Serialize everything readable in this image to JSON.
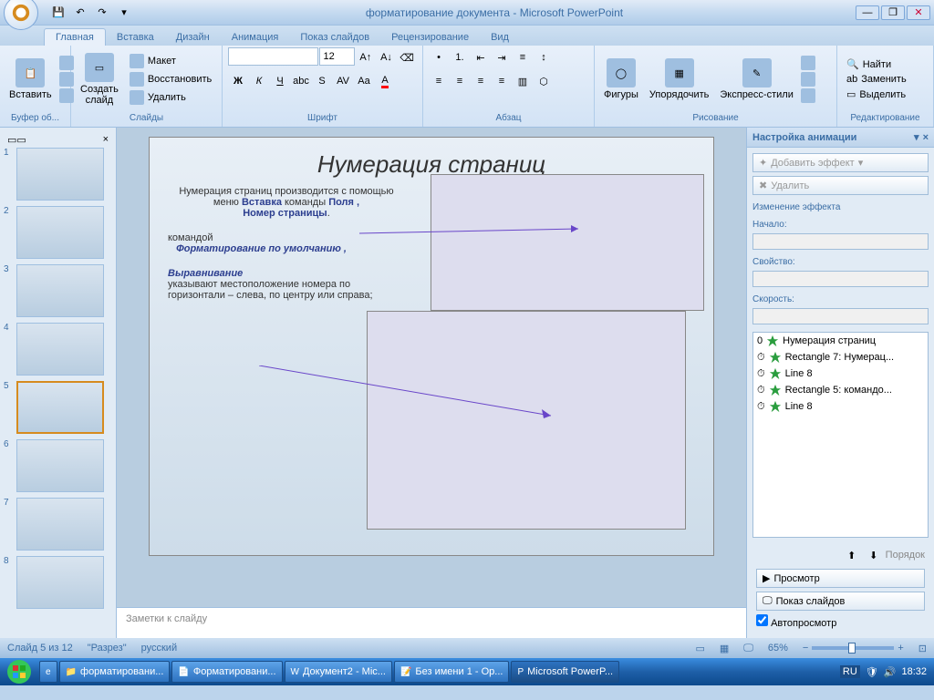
{
  "title": "форматирование документа - Microsoft PowerPoint",
  "ribbon_tabs": [
    "Главная",
    "Вставка",
    "Дизайн",
    "Анимация",
    "Показ слайдов",
    "Рецензирование",
    "Вид"
  ],
  "groups": {
    "clipboard": {
      "label": "Буфер об...",
      "paste": "Вставить"
    },
    "slides": {
      "label": "Слайды",
      "new": "Создать\nслайд",
      "layout": "Макет",
      "reset": "Восстановить",
      "delete": "Удалить"
    },
    "font": {
      "label": "Шрифт",
      "name": "",
      "size": "12"
    },
    "paragraph": {
      "label": "Абзац"
    },
    "drawing": {
      "label": "Рисование",
      "shapes": "Фигуры",
      "arrange": "Упорядочить",
      "quick": "Экспресс-стили"
    },
    "editing": {
      "label": "Редактирование",
      "find": "Найти",
      "replace": "Заменить",
      "select": "Выделить"
    }
  },
  "slide": {
    "title": "Нумерация страниц",
    "line1": "Нумерация страниц производится с помощью",
    "line2a": "меню ",
    "line2b": "Вставка",
    "line2c": " команды ",
    "line2d": "Поля ,",
    "line2e": "Номер страницы",
    "line3a": "командой",
    "line3b": "Форматирование по умолчанию ,",
    "line4a": "Выравнивание",
    "line4b": "указывают местоположение номера по горизонтали – слева, по центру или справа;"
  },
  "notes_placeholder": "Заметки к слайду",
  "anim": {
    "title": "Настройка анимации",
    "add": "Добавить эффект",
    "remove": "Удалить",
    "change": "Изменение эффекта",
    "start": "Начало:",
    "prop": "Свойство:",
    "speed": "Скорость:",
    "items": [
      "Нумерация страниц",
      "Rectangle 7: Нумерац...",
      "Line 8",
      "Rectangle 5:  командо...",
      "Line 8"
    ],
    "order": "Порядок",
    "preview": "Просмотр",
    "show": "Показ слайдов",
    "auto": "Автопросмотр"
  },
  "status": {
    "slide": "Слайд 5 из 12",
    "theme": "\"Разрез\"",
    "lang": "русский",
    "zoom": "65%"
  },
  "taskbar": {
    "items": [
      "форматировани...",
      "Форматировани...",
      "Документ2 - Mic...",
      "Без имени 1 - Op...",
      "Microsoft PowerP..."
    ],
    "lang": "RU",
    "time": "18:32"
  }
}
